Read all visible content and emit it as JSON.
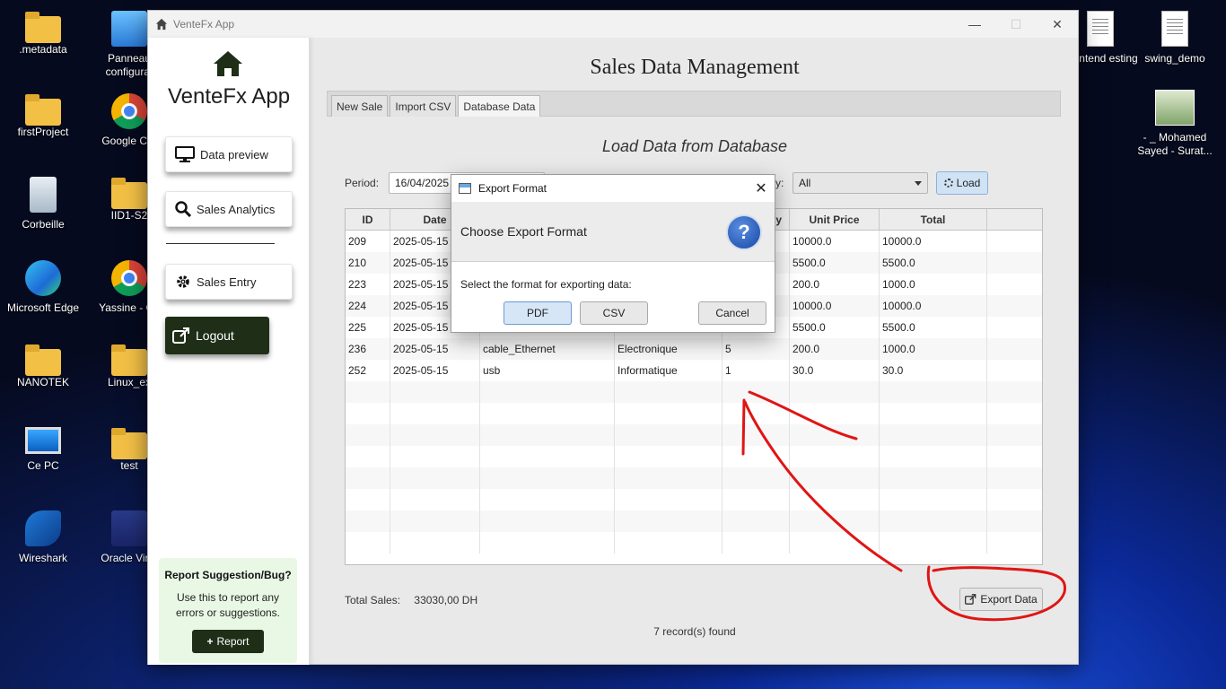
{
  "desktop": {
    "icons": [
      {
        "label": ".metadata"
      },
      {
        "label": "Panneau configurat"
      },
      {
        "label": "firstProject"
      },
      {
        "label": "Google Chr"
      },
      {
        "label": "Corbeille"
      },
      {
        "label": "IID1-S2"
      },
      {
        "label": "Microsoft Edge"
      },
      {
        "label": "Yassine - Ch"
      },
      {
        "label": "NANOTEK"
      },
      {
        "label": "Linux_ex"
      },
      {
        "label": "Ce PC"
      },
      {
        "label": "test"
      },
      {
        "label": "Wireshark"
      },
      {
        "label": "Oracle Virtu"
      },
      {
        "label": "Frontend esting"
      },
      {
        "label": "swing_demo"
      },
      {
        "label": "- _ Mohamed Sayed - Surat..."
      }
    ]
  },
  "window": {
    "title": "VenteFx App",
    "controls": {
      "minimize": "—",
      "maximize": "☐",
      "close": "✕"
    }
  },
  "sidebar": {
    "brand": "VenteFx App",
    "items": [
      {
        "label": "Data preview"
      },
      {
        "label": "Sales Analytics"
      },
      {
        "label": "Sales Entry"
      }
    ],
    "logout": "Logout",
    "report": {
      "title": "Report Suggestion/Bug?",
      "description": "Use this to report any errors or suggestions.",
      "button": "Report"
    }
  },
  "main": {
    "title": "Sales Data Management",
    "tabs": [
      {
        "label": "New Sale"
      },
      {
        "label": "Import CSV"
      },
      {
        "label": "Database Data",
        "active": true
      }
    ],
    "section_title": "Load Data from Database",
    "filters": {
      "period_label": "Period:",
      "period_value": "16/04/2025",
      "category_label_suffix": "y:",
      "category_value": "All",
      "load_button": "Load"
    },
    "table": {
      "columns": [
        "ID",
        "Date",
        "",
        "",
        "y",
        "Unit Price",
        "Total",
        ""
      ],
      "rows": [
        [
          "209",
          "2025-05-15",
          "",
          "",
          "",
          "10000.0",
          "10000.0"
        ],
        [
          "210",
          "2025-05-15",
          "",
          "",
          "",
          "5500.0",
          "5500.0"
        ],
        [
          "223",
          "2025-05-15",
          "",
          "",
          "",
          "200.0",
          "1000.0"
        ],
        [
          "224",
          "2025-05-15",
          "",
          "",
          "",
          "10000.0",
          "10000.0"
        ],
        [
          "225",
          "2025-05-15",
          "",
          "",
          "",
          "5500.0",
          "5500.0"
        ],
        [
          "236",
          "2025-05-15",
          "cable_Ethernet",
          "Electronique",
          "5",
          "200.0",
          "1000.0"
        ],
        [
          "252",
          "2025-05-15",
          "usb",
          "Informatique",
          "1",
          "30.0",
          "30.0"
        ]
      ]
    },
    "total_label": "Total Sales:",
    "total_value": "33030,00 DH",
    "export_button": "Export Data",
    "records_text": "7 record(s) found"
  },
  "dialog": {
    "title": "Export Format",
    "header": "Choose Export Format",
    "message": "Select the format for exporting data:",
    "buttons": {
      "pdf": "PDF",
      "csv": "CSV",
      "cancel": "Cancel"
    },
    "close": "✕"
  },
  "colors": {
    "sidebar_dark": "#1e2e17",
    "report_bg": "#e9f8e5",
    "annotation": "#e01515"
  }
}
